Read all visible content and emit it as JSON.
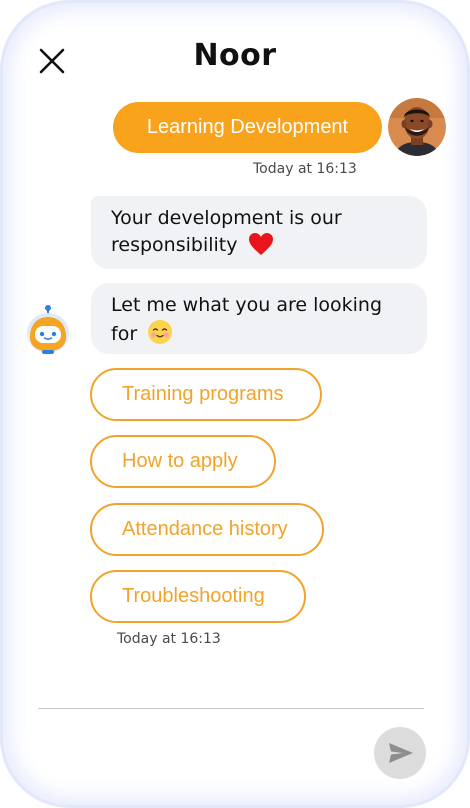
{
  "header": {
    "title": "Noor",
    "close_icon": "close-icon"
  },
  "conversation": {
    "user_message": {
      "text": "Learning Development",
      "timestamp": "Today at 16:13",
      "bubble_color": "#f9a21b",
      "avatar": "user-avatar"
    },
    "bot_messages": [
      {
        "text": "Your development is our responsibility",
        "emoji": "red-heart-emoji"
      },
      {
        "text": "Let me what you are looking for",
        "emoji": "smiling-face-emoji"
      }
    ],
    "bot_avatar": "robot-icon",
    "quick_replies": [
      {
        "label": "Training programs"
      },
      {
        "label": "How to apply"
      },
      {
        "label": "Attendance history"
      },
      {
        "label": "Troubleshooting"
      }
    ],
    "quick_reply_color": "#f2a32a",
    "bot_timestamp": "Today at 16:13"
  },
  "composer": {
    "placeholder": "",
    "send_icon": "send-icon"
  }
}
